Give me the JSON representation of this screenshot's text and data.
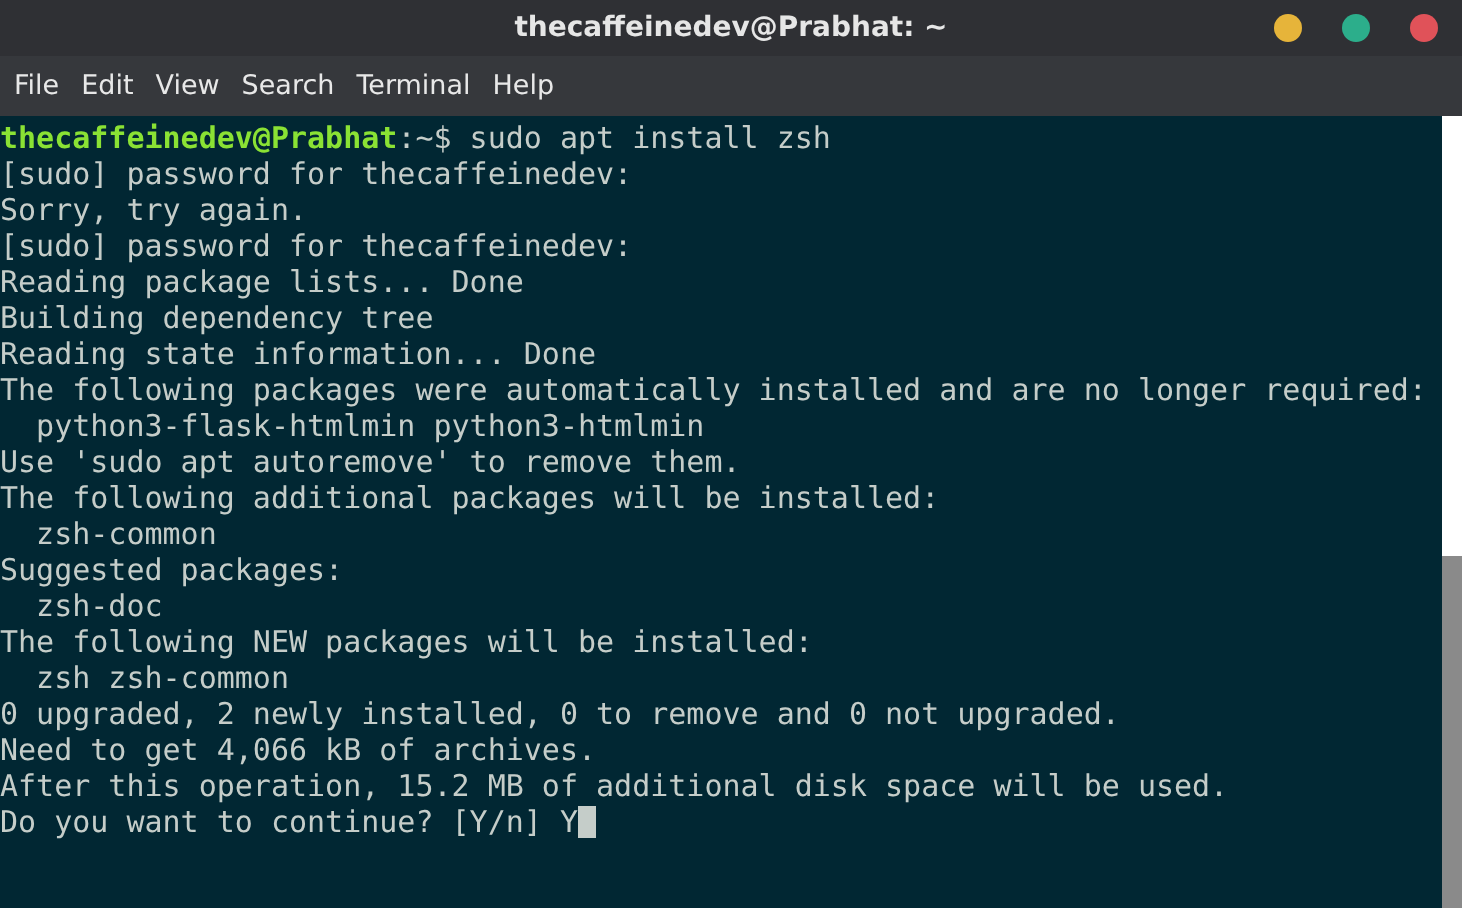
{
  "window": {
    "title": "thecaffeinedev@Prabhat: ~"
  },
  "menu": [
    "File",
    "Edit",
    "View",
    "Search",
    "Terminal",
    "Help"
  ],
  "terminal": {
    "lines": [
      {
        "kind": "prompt",
        "user": "thecaffeinedev@Prabhat",
        "text": ":~$ sudo apt install zsh"
      },
      {
        "kind": "output",
        "text": "[sudo] password for thecaffeinedev:"
      },
      {
        "kind": "output",
        "text": "Sorry, try again."
      },
      {
        "kind": "output",
        "text": "[sudo] password for thecaffeinedev:"
      },
      {
        "kind": "output",
        "text": "Reading package lists... Done"
      },
      {
        "kind": "output",
        "text": "Building dependency tree"
      },
      {
        "kind": "output",
        "text": "Reading state information... Done"
      },
      {
        "kind": "output",
        "text": "The following packages were automatically installed and are no longer required:"
      },
      {
        "kind": "output",
        "text": "  python3-flask-htmlmin python3-htmlmin"
      },
      {
        "kind": "output",
        "text": "Use 'sudo apt autoremove' to remove them."
      },
      {
        "kind": "output",
        "text": "The following additional packages will be installed:"
      },
      {
        "kind": "output",
        "text": "  zsh-common"
      },
      {
        "kind": "output",
        "text": "Suggested packages:"
      },
      {
        "kind": "output",
        "text": "  zsh-doc"
      },
      {
        "kind": "output",
        "text": "The following NEW packages will be installed:"
      },
      {
        "kind": "output",
        "text": "  zsh zsh-common"
      },
      {
        "kind": "output",
        "text": "0 upgraded, 2 newly installed, 0 to remove and 0 not upgraded."
      },
      {
        "kind": "output",
        "text": "Need to get 4,066 kB of archives."
      },
      {
        "kind": "output",
        "text": "After this operation, 15.2 MB of additional disk space will be used."
      },
      {
        "kind": "input",
        "text": "Do you want to continue? [Y/n] Y",
        "cursor": true
      }
    ]
  }
}
